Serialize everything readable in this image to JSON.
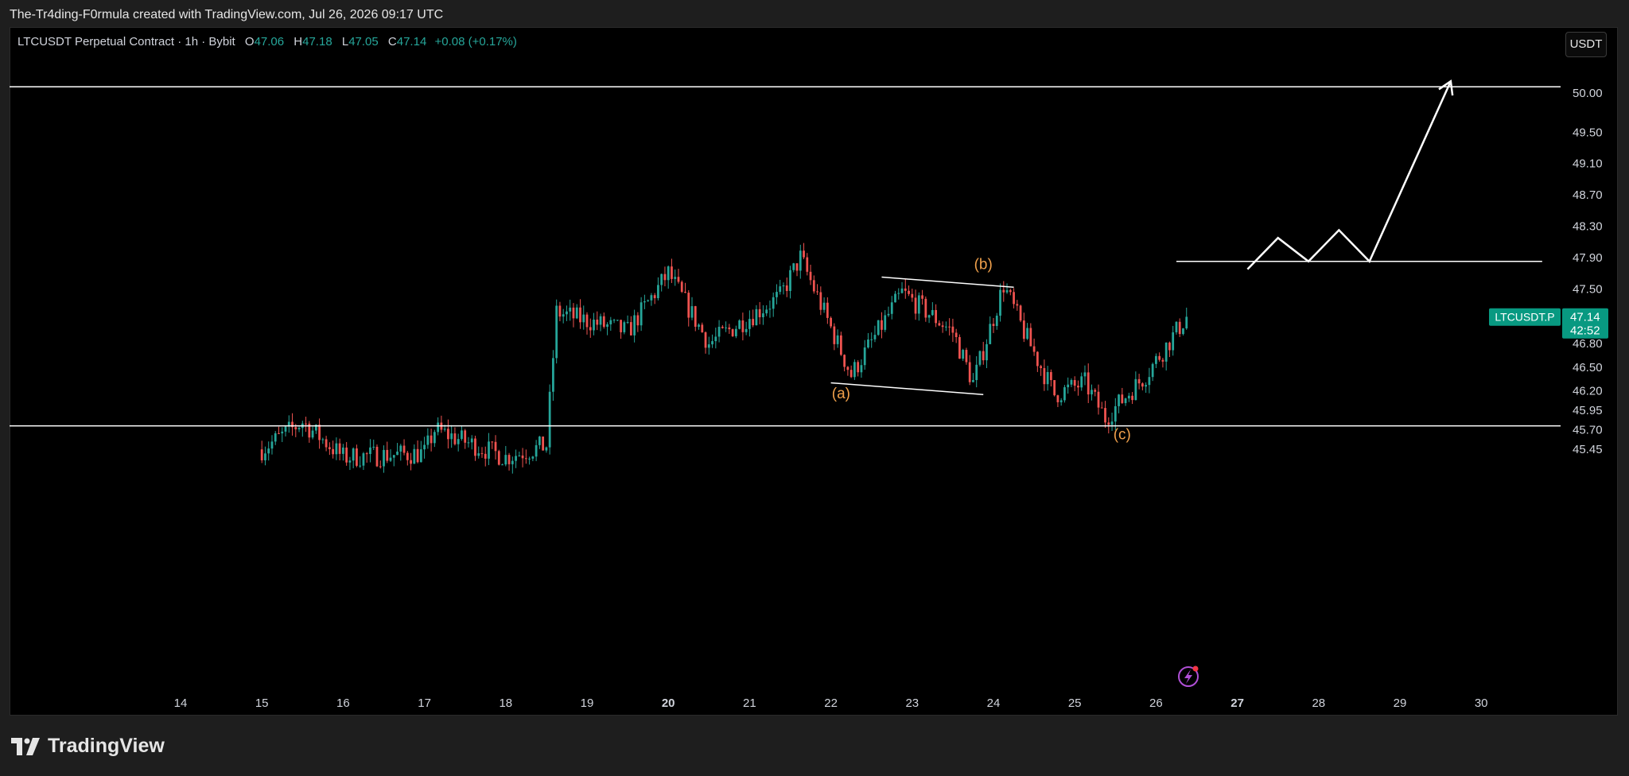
{
  "caption": "The-Tr4ding-F0rmula created with TradingView.com, Jul 26, 2026 09:17 UTC",
  "currency_button": "USDT",
  "brand": "TradingView",
  "header": {
    "symbol_text": "LTCUSDT Perpetual Contract · 1h · Bybit",
    "o_label": "O",
    "o_value": "47.06",
    "h_label": "H",
    "h_value": "47.18",
    "l_label": "L",
    "l_value": "47.05",
    "c_label": "C",
    "c_value": "47.14",
    "change": "+0.08 (+0.17%)"
  },
  "colors": {
    "up": "#26a69a",
    "down": "#ef5350",
    "wave_label": "#f0a04b",
    "drawing": "#ffffff",
    "price_tag_bg": "#089981"
  },
  "chart_data": {
    "type": "candlestick",
    "symbol": "LTCUSDT.P",
    "interval": "1h",
    "x_tick_labels": [
      "14",
      "15",
      "16",
      "17",
      "18",
      "19",
      "20",
      "21",
      "22",
      "23",
      "24",
      "25",
      "26",
      "27",
      "28",
      "29",
      "30"
    ],
    "y_tick_labels": [
      "50.00",
      "49.50",
      "49.10",
      "48.70",
      "48.30",
      "47.90",
      "47.50",
      "46.80",
      "46.50",
      "46.20",
      "45.95",
      "45.70",
      "45.45"
    ],
    "y_ticks": [
      50.0,
      49.5,
      49.1,
      48.7,
      48.3,
      47.9,
      47.5,
      46.8,
      46.5,
      46.2,
      45.95,
      45.7,
      45.45
    ],
    "ylim": [
      45.25,
      50.1
    ],
    "last_price": "47.14",
    "countdown": "42:52",
    "price_tag_label": "LTCUSDT.P",
    "approx_close_path": [
      {
        "date": "Jul 15",
        "value": 45.45
      },
      {
        "date": "Jul 15 12:00",
        "value": 45.8
      },
      {
        "date": "Jul 16",
        "value": 45.35
      },
      {
        "date": "Jul 17",
        "value": 45.4
      },
      {
        "date": "Jul 17 03:00",
        "value": 45.7
      },
      {
        "date": "Jul 18",
        "value": 45.35
      },
      {
        "date": "Jul 18 12:00",
        "value": 45.5
      },
      {
        "date": "Jul 18 15:00",
        "value": 47.2
      },
      {
        "date": "Jul 19 12:00",
        "value": 46.95
      },
      {
        "date": "Jul 20",
        "value": 47.7
      },
      {
        "date": "Jul 20 12:00",
        "value": 46.8
      },
      {
        "date": "Jul 21 09:00",
        "value": 47.4
      },
      {
        "date": "Jul 21 15:00",
        "value": 47.9
      },
      {
        "date": "Jul 22 06:00",
        "value": 46.4
      },
      {
        "date": "Jul 22 21:00",
        "value": 47.45
      },
      {
        "date": "Jul 23 12:00",
        "value": 46.95
      },
      {
        "date": "Jul 23 18:00",
        "value": 46.3
      },
      {
        "date": "Jul 24 03:00",
        "value": 47.55
      },
      {
        "date": "Jul 24 09:00",
        "value": 46.95
      },
      {
        "date": "Jul 24 18:00",
        "value": 46.15
      },
      {
        "date": "Jul 25 03:00",
        "value": 46.3
      },
      {
        "date": "Jul 25 09:00",
        "value": 45.85
      },
      {
        "date": "Jul 25 21:00",
        "value": 46.4
      },
      {
        "date": "Jul 26 09:00",
        "value": 47.14
      }
    ],
    "horizontal_lines": [
      {
        "value": 50.08
      },
      {
        "value": 45.75
      }
    ],
    "short_level": {
      "from": "Jul 26 06:00",
      "to": "Jul 30 18:00",
      "value": 47.85
    },
    "wave_labels": [
      {
        "text": "(a)",
        "date": "Jul 22 03:00",
        "value": 46.1
      },
      {
        "text": "(b)",
        "date": "Jul 23 21:00",
        "value": 47.75
      },
      {
        "text": "(c)",
        "date": "Jul 25 14:00",
        "value": 45.58
      }
    ],
    "channel": {
      "upper": [
        {
          "date": "Jul 22 15:00",
          "value": 47.65
        },
        {
          "date": "Jul 24 06:00",
          "value": 47.52
        }
      ],
      "lower": [
        {
          "date": "Jul 22",
          "value": 46.3
        },
        {
          "date": "Jul 23 21:00",
          "value": 46.15
        }
      ]
    },
    "projection": [
      {
        "date": "Jul 27 03:00",
        "value": 47.75
      },
      {
        "date": "Jul 27 12:00",
        "value": 48.15
      },
      {
        "date": "Jul 27 21:00",
        "value": 47.85
      },
      {
        "date": "Jul 28 06:00",
        "value": 48.25
      },
      {
        "date": "Jul 28 15:00",
        "value": 47.85
      },
      {
        "date": "Jul 29 15:00",
        "value": 50.15
      }
    ]
  }
}
